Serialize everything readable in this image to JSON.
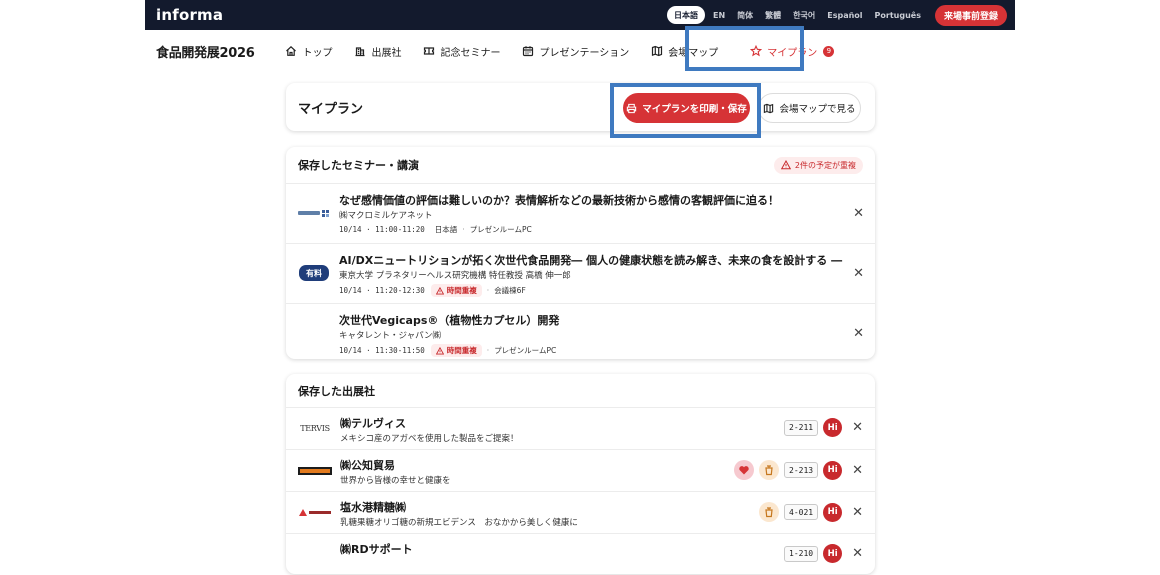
{
  "topbar": {
    "logo": "informa",
    "languages": [
      "日本語",
      "EN",
      "简体",
      "繁體",
      "한국어",
      "Español",
      "Português"
    ],
    "register_label": "来場事前登録"
  },
  "nav": {
    "brand": "食品開発展2026",
    "items": [
      {
        "label": "トップ",
        "icon": "home-icon"
      },
      {
        "label": "出展社",
        "icon": "building-icon"
      },
      {
        "label": "記念セミナー",
        "icon": "ticket-icon"
      },
      {
        "label": "プレゼンテーション",
        "icon": "calendar-icon"
      },
      {
        "label": "会場マップ",
        "icon": "map-icon"
      },
      {
        "label": "マイプラン",
        "icon": "star-icon"
      }
    ],
    "myplan_count": "9"
  },
  "plan": {
    "title": "マイプラン",
    "print_label": "マイプランを印刷・保存",
    "map_label": "会場マップで見る"
  },
  "seminars": {
    "title": "保存したセミナー・講演",
    "conflict_notice": "2件の予定が重複",
    "items": [
      {
        "logo": "MACROMILL",
        "title": "なぜ感情価値の評価は難しいのか？表情解析などの最新技術から感情の客観評価に迫る！",
        "org": "㈱マクロミルケアネット",
        "time": "10/14 · 11:00-11:20",
        "lang": "日本語",
        "conflict": "",
        "room": "プレゼンルームPC"
      },
      {
        "logo": "有料",
        "title": "AI/DXニュートリションが拓く次世代食品開発― 個人の健康状態を読み解き、未来の食を設計する ―",
        "org": "東京大学 プラネタリーヘルス研究機構 特任教授 高橋 伸一郎",
        "time": "10/14 · 11:20-12:30",
        "lang": "",
        "conflict": "時間重複",
        "room": "会議棟6F"
      },
      {
        "logo": "",
        "title": "次世代Vegicaps®（植物性カプセル）開発",
        "org": "キャタレント・ジャパン㈱",
        "time": "10/14 · 11:30-11:50",
        "lang": "",
        "conflict": "時間重複",
        "room": "プレゼンルームPC"
      }
    ]
  },
  "exhibitors": {
    "title": "保存した出展社",
    "items": [
      {
        "logo": "TERVIS",
        "name": "㈱テルヴィス",
        "desc": "メキシコ産のアガベを使用した製品をご提案！",
        "booth": "2-211",
        "hi": "Hi",
        "categories": []
      },
      {
        "logo": "COMEX",
        "name": "㈱公知貿易",
        "desc": "世界から皆様の幸せと健康を",
        "booth": "2-213",
        "hi": "Hi",
        "categories": [
          "heart-icon",
          "cup-icon"
        ]
      },
      {
        "logo": "SHIOMIZUKO",
        "name": "塩水港精糖㈱",
        "desc": "乳糖果糖オリゴ糖の新規エビデンス　おなかから美しく健康に",
        "booth": "4-021",
        "hi": "Hi",
        "categories": [
          "cup-icon"
        ]
      },
      {
        "logo": "",
        "name": "㈱RDサポート",
        "desc": "",
        "booth": "1-210",
        "hi": "Hi",
        "categories": []
      }
    ]
  },
  "colors": {
    "accent": "#d63336",
    "topbar": "#131a2d",
    "highlight": "#3f7ac0"
  }
}
